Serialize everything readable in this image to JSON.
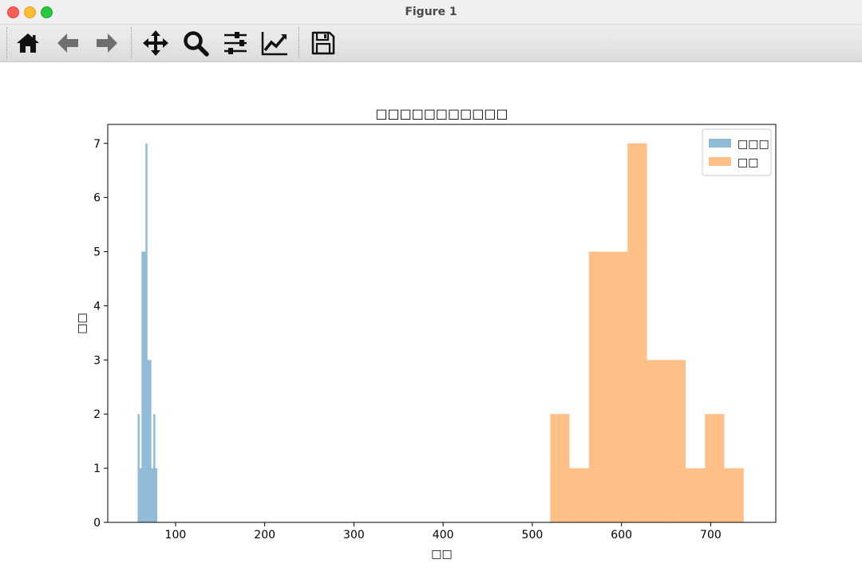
{
  "window": {
    "title": "Figure 1"
  },
  "toolbar": {
    "tools": [
      {
        "name": "home-button",
        "icon": "home-icon"
      },
      {
        "name": "back-button",
        "icon": "arrow-left-icon"
      },
      {
        "name": "forward-button",
        "icon": "arrow-right-icon"
      },
      {
        "name": "pan-button",
        "icon": "move-icon"
      },
      {
        "name": "zoom-button",
        "icon": "magnifier-icon"
      },
      {
        "name": "configure-subplots-button",
        "icon": "sliders-icon"
      },
      {
        "name": "edit-axes-button",
        "icon": "line-chart-icon"
      },
      {
        "name": "save-button",
        "icon": "floppy-disk-icon"
      }
    ]
  },
  "chart_data": {
    "type": "bar",
    "title": "□□□□□□□□□□□",
    "xlabel": "□□",
    "ylabel": "□□",
    "xlim": [
      24,
      773
    ],
    "ylim": [
      0,
      7.35
    ],
    "xticks": [
      100,
      200,
      300,
      400,
      500,
      600,
      700
    ],
    "yticks": [
      0,
      1,
      2,
      3,
      4,
      5,
      6,
      7
    ],
    "legend_position": "top-right",
    "grid": false,
    "series": [
      {
        "name": "□□□",
        "color": "#1f77b4",
        "opacity": 0.5,
        "bins": [
          {
            "x0": 57.5,
            "x1": 59.7,
            "count": 2
          },
          {
            "x0": 59.7,
            "x1": 61.9,
            "count": 1
          },
          {
            "x0": 61.9,
            "x1": 64.1,
            "count": 5
          },
          {
            "x0": 64.1,
            "x1": 66.3,
            "count": 5
          },
          {
            "x0": 66.3,
            "x1": 68.5,
            "count": 7
          },
          {
            "x0": 68.5,
            "x1": 70.7,
            "count": 3
          },
          {
            "x0": 70.7,
            "x1": 72.9,
            "count": 3
          },
          {
            "x0": 72.9,
            "x1": 75.1,
            "count": 1
          },
          {
            "x0": 75.1,
            "x1": 77.3,
            "count": 2
          },
          {
            "x0": 77.3,
            "x1": 79.5,
            "count": 1
          }
        ]
      },
      {
        "name": "□□",
        "color": "#ff7f0e",
        "opacity": 0.5,
        "bins": [
          {
            "x0": 520.0,
            "x1": 541.7,
            "count": 2
          },
          {
            "x0": 541.7,
            "x1": 563.4,
            "count": 1
          },
          {
            "x0": 563.4,
            "x1": 585.1,
            "count": 5
          },
          {
            "x0": 585.1,
            "x1": 606.8,
            "count": 5
          },
          {
            "x0": 606.8,
            "x1": 628.5,
            "count": 7
          },
          {
            "x0": 628.5,
            "x1": 650.2,
            "count": 3
          },
          {
            "x0": 650.2,
            "x1": 671.9,
            "count": 3
          },
          {
            "x0": 671.9,
            "x1": 693.6,
            "count": 1
          },
          {
            "x0": 693.6,
            "x1": 715.3,
            "count": 2
          },
          {
            "x0": 715.3,
            "x1": 737.0,
            "count": 1
          }
        ]
      }
    ]
  }
}
